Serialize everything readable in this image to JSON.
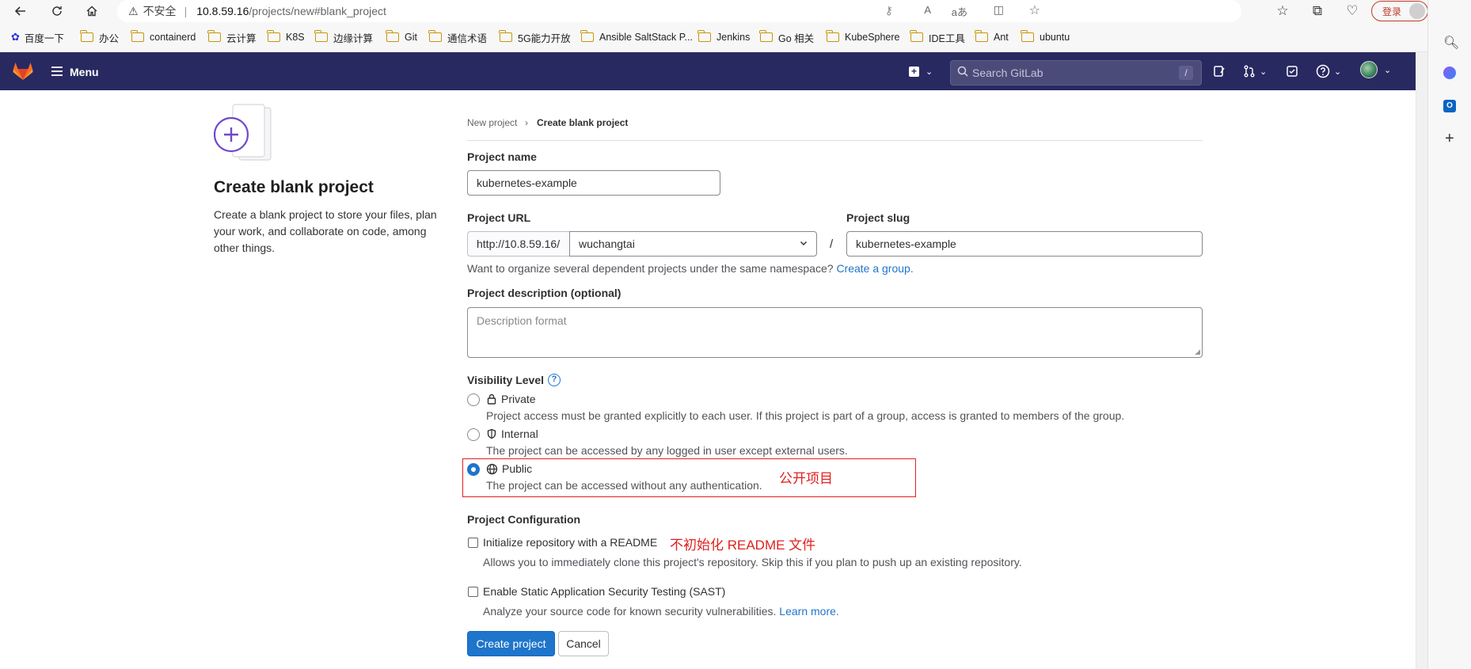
{
  "browser": {
    "security_label": "不安全",
    "url_host": "10.8.59.16",
    "url_path": "/projects/new#blank_project",
    "login_label": "登录",
    "bookmarks": [
      "百度一下",
      "办公",
      "containerd",
      "云计算",
      "K8S",
      "边缘计算",
      "Git",
      "通信术语",
      "5G能力开放",
      "Ansible SaltStack P...",
      "Jenkins",
      "Go 相关",
      "KubeSphere",
      "IDE工具",
      "Ant",
      "ubuntu"
    ]
  },
  "header": {
    "menu_label": "Menu",
    "search_placeholder": "Search GitLab",
    "search_shortcut": "/"
  },
  "left": {
    "title": "Create blank project",
    "description": "Create a blank project to store your files, plan your work, and collaborate on code, among other things."
  },
  "breadcrumb": {
    "parent": "New project",
    "current": "Create blank project"
  },
  "form": {
    "project_name_label": "Project name",
    "project_name_value": "kubernetes-example",
    "project_url_label": "Project URL",
    "url_prefix": "http://10.8.59.16/",
    "namespace_value": "wuchangtai",
    "slash": "/",
    "project_slug_label": "Project slug",
    "project_slug_value": "kubernetes-example",
    "namespace_hint": "Want to organize several dependent projects under the same namespace?",
    "namespace_hint_link": "Create a group.",
    "description_label": "Project description (optional)",
    "description_placeholder": "Description format",
    "visibility_label": "Visibility Level",
    "visibility_options": [
      {
        "title": "Private",
        "desc": "Project access must be granted explicitly to each user. If this project is part of a group, access is granted to members of the group.",
        "selected": false
      },
      {
        "title": "Internal",
        "desc": "The project can be accessed by any logged in user except external users.",
        "selected": false
      },
      {
        "title": "Public",
        "desc": "The project can be accessed without any authentication.",
        "selected": true
      }
    ],
    "config_label": "Project Configuration",
    "readme_label": "Initialize repository with a README",
    "readme_desc": "Allows you to immediately clone this project's repository. Skip this if you plan to push up an existing repository.",
    "sast_label": "Enable Static Application Security Testing (SAST)",
    "sast_desc": "Analyze your source code for known security vulnerabilities.",
    "sast_link": "Learn more.",
    "create_button": "Create project",
    "cancel_button": "Cancel"
  },
  "annotations": {
    "public_note": "公开项目",
    "readme_note": "不初始化 README 文件"
  },
  "colors": {
    "header_bg": "#292961",
    "primary": "#1f75cb",
    "annotation_red": "#e0201f"
  }
}
